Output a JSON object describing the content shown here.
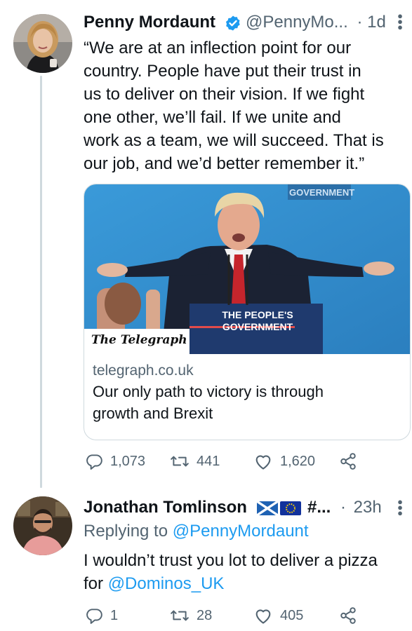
{
  "tweet1": {
    "display_name": "Penny Mordaunt",
    "handle": "@PennyMo...",
    "separator": "·",
    "time": "1d",
    "text_lines": [
      "“We are at an inflection point for our",
      "country. People have put their trust in",
      "us to deliver on their vision. If we fight",
      "one other, we’ll fail. If we unite and",
      "work as a team, we will succeed. That is",
      "our job, and we’d better remember it.”"
    ],
    "card": {
      "image_publisher_logo": "The Telegraph",
      "podium_sign_line1": "THE PEOPLE'S",
      "podium_sign_line2": "GOVERNMENT",
      "backdrop_sign": "GOVERNMENT",
      "domain": "telegraph.co.uk",
      "title_line1": "Our only path to victory is through",
      "title_line2": "growth and Brexit"
    },
    "stats": {
      "replies": "1,073",
      "retweets": "441",
      "likes": "1,620"
    },
    "icons": [
      "verified-badge-icon",
      "reply-icon",
      "retweet-icon",
      "like-icon",
      "share-icon",
      "more-icon"
    ]
  },
  "tweet2": {
    "display_name": "Jonathan Tomlinson",
    "handle": "#...",
    "separator": "·",
    "time": "23h",
    "replying_prefix": "Replying to",
    "replying_to": "@PennyMordaunt",
    "text_line1": "I wouldn’t trust you lot to deliver a pizza",
    "text_line2_prefix": "for",
    "mention": "@Dominos_UK",
    "stats": {
      "replies": "1",
      "retweets": "28",
      "likes": "405"
    },
    "icons": [
      "scotland-flag-icon",
      "eu-flag-icon",
      "reply-icon",
      "retweet-icon",
      "like-icon",
      "share-icon",
      "more-icon"
    ]
  },
  "colors": {
    "text": "#0f1419",
    "secondary": "#536471",
    "link": "#1d9bf0",
    "verified": "#1d9bf0",
    "border": "#cfd9de"
  }
}
